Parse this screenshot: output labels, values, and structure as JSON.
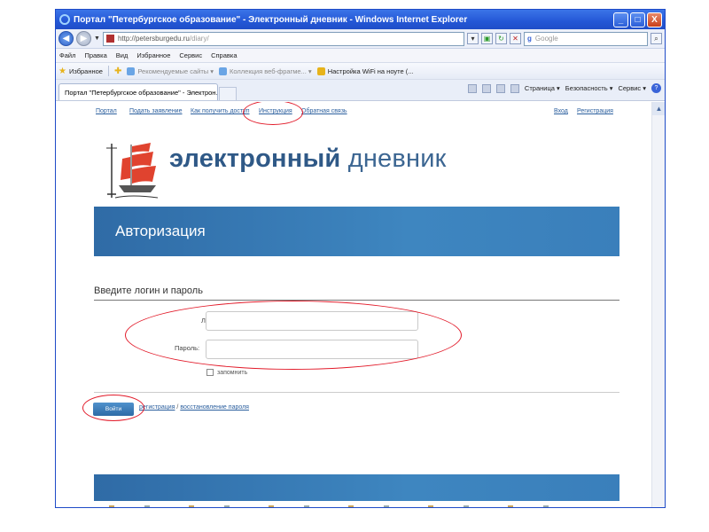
{
  "window": {
    "title": "Портал \"Петербургское образование\" - Электронный дневник - Windows Internet Explorer",
    "buttons": {
      "minimize": "_",
      "maximize": "□",
      "close": "X"
    }
  },
  "address_bar": {
    "url_host": "http://petersburgedu.ru",
    "url_path": "/diary/",
    "search_placeholder": "Google",
    "search_brand": "g"
  },
  "menu": [
    "Файл",
    "Правка",
    "Вид",
    "Избранное",
    "Сервис",
    "Справка"
  ],
  "favorites_bar": {
    "favorites_label": "Избранное",
    "items": [
      {
        "label": "Рекомендуемые сайты ▾",
        "dim": true
      },
      {
        "label": "Коллекция веб-фрагме... ▾",
        "dim": true
      },
      {
        "label": "Настройка WiFi на ноуте (...",
        "dim": false
      }
    ]
  },
  "tabs": [
    {
      "label": "Портал \"Петербургское образование\" - Электрон..."
    }
  ],
  "command_bar": {
    "page": "Страница ▾",
    "safety": "Безопасность ▾",
    "tools": "Сервис ▾",
    "help": "?"
  },
  "site_nav": {
    "left": [
      "Портал",
      "Подать заявление",
      "Как получить доступ",
      "Инструкция",
      "Обратная связь"
    ],
    "right": [
      "Вход",
      "Регистрация"
    ]
  },
  "logo": {
    "bold": "электронный",
    "regular": "дневник"
  },
  "auth": {
    "banner_title": "Авторизация",
    "heading": "Введите логин и пароль",
    "login_label": "Логин:",
    "password_label": "Пароль:",
    "login_value": "",
    "password_value": "",
    "remember_label": "запомнить",
    "remember_checked": false,
    "submit_label": "Войти",
    "register_link": "регистрация",
    "separator": "/",
    "recover_link": "восстановление пароля"
  },
  "colors": {
    "accent_blue": "#2f6ba6",
    "link_blue": "#2b5f9e",
    "annotation_red": "#e21b2a",
    "sail_red": "#e0432f"
  }
}
